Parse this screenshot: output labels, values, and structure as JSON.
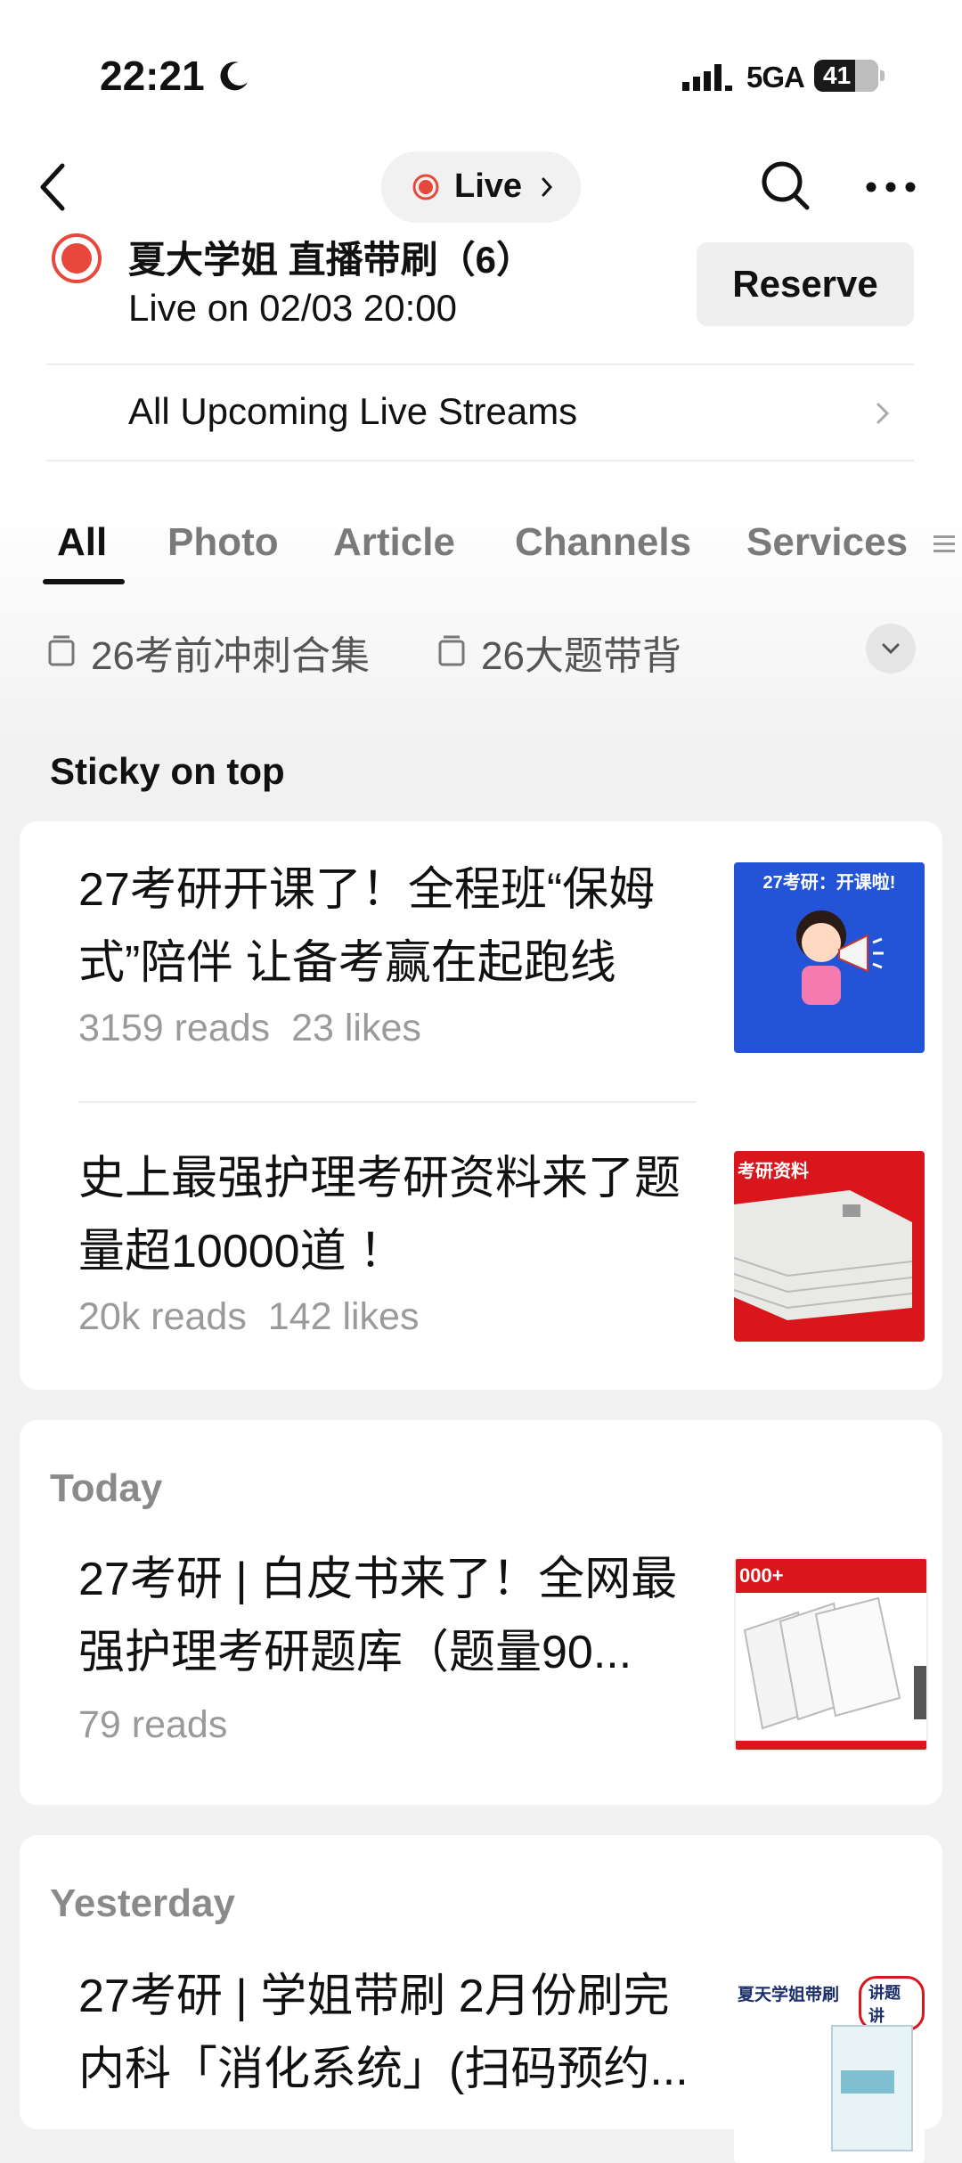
{
  "status_bar": {
    "time": "22:21",
    "network": "5GA",
    "battery": "41"
  },
  "nav": {
    "live_label": "Live"
  },
  "live_reserve": {
    "title": "夏大学姐 直播带刷（6）",
    "time": "Live on 02/03 20:00",
    "button": "Reserve",
    "upcoming": "All Upcoming Live Streams"
  },
  "tabs": [
    "All",
    "Photo",
    "Article",
    "Channels",
    "Services"
  ],
  "active_tab": "All",
  "collections": [
    "26考前冲刺合集",
    "26大题带背"
  ],
  "sticky": {
    "label": "Sticky on top",
    "items": [
      {
        "title": "27考研开课了！全程班“保姆式”陪伴 让备考赢在起跑线",
        "reads": "3159 reads",
        "likes": "23 likes",
        "thumb_text": "27考研：开课啦!"
      },
      {
        "title": "史上最强护理考研资料来了题量超10000道 ！",
        "reads": "20k reads",
        "likes": "142 likes",
        "thumb_text": "考研资料"
      }
    ]
  },
  "today": {
    "label": "Today",
    "items": [
      {
        "title": "27考研 | 白皮书来了！全网最强护理考研题库（题量90...",
        "reads": "79 reads",
        "thumb_text": "000+"
      }
    ]
  },
  "yesterday": {
    "label": "Yesterday",
    "items": [
      {
        "title": "27考研 | 学姐带刷 2月份刷完内科「消化系统」(扫码预约...",
        "thumb_text": "夏天学姐带刷",
        "thumb_badge": "讲题讲"
      }
    ]
  },
  "colors": {
    "accent_red": "#e8473b",
    "thumb_blue": "#2354d8",
    "thumb_red": "#d8161b"
  }
}
